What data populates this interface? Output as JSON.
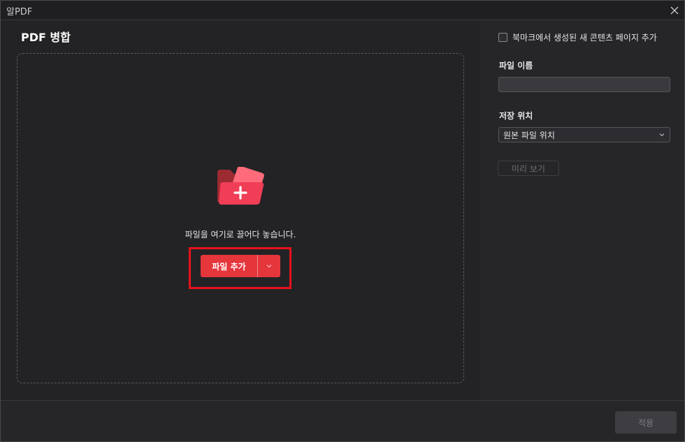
{
  "window": {
    "title": "알PDF"
  },
  "left": {
    "title": "PDF 병합",
    "drop_text": "파일을 여기로 끌어다 놓습니다.",
    "add_button_label": "파일 추가"
  },
  "right": {
    "bookmark_label": "북마크에서 생성된 새 콘텐츠 페이지 추가",
    "bookmark_checked": false,
    "filename_label": "파일 이름",
    "filename_value": "",
    "location_label": "저장 위치",
    "location_value": "원본 파일 위치",
    "preview_label": "미리 보기"
  },
  "footer": {
    "apply_label": "적용"
  },
  "icons": {
    "close": "close-icon",
    "folder": "folder-add-icon",
    "chevron": "chevron-down-icon"
  },
  "colors": {
    "accent": "#e5363c",
    "highlight": "#e8121b",
    "background": "#262629"
  }
}
